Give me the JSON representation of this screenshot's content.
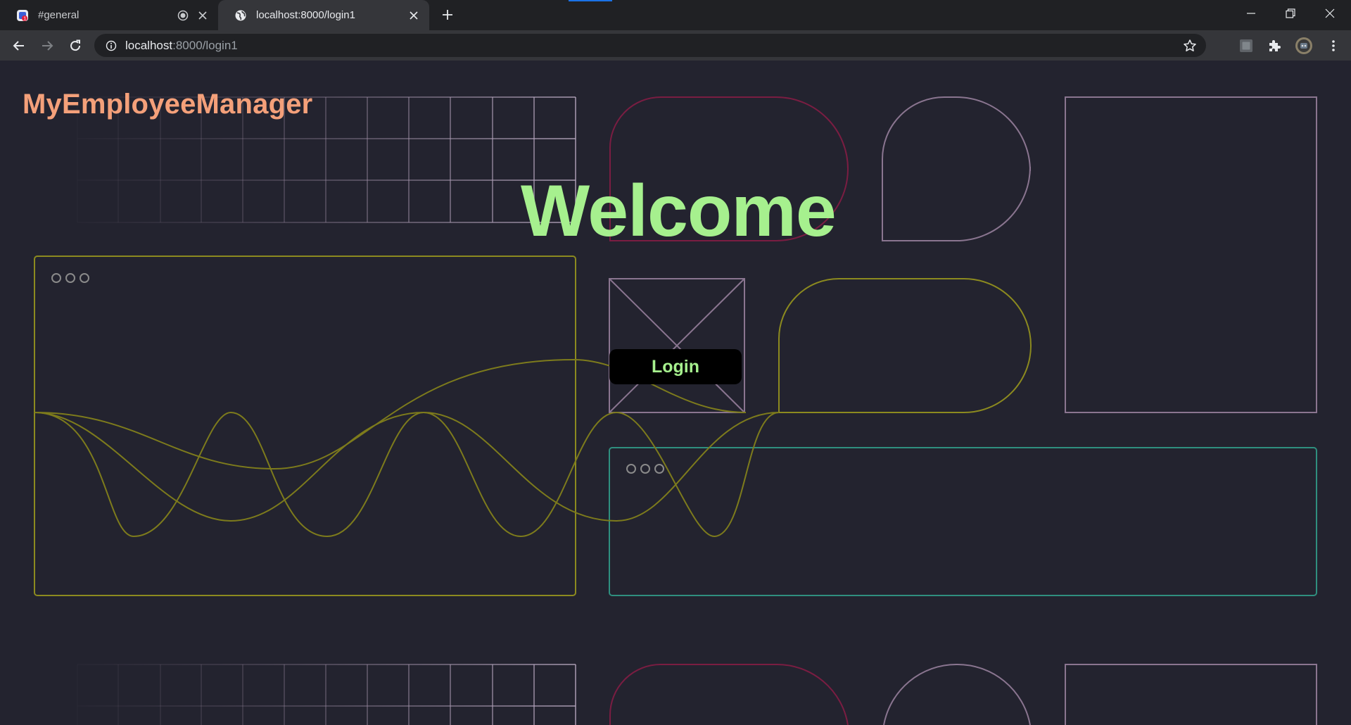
{
  "browser": {
    "tabs": [
      {
        "title": "#general",
        "active": false
      },
      {
        "title": "localhost:8000/login1",
        "active": true
      }
    ],
    "url_host": "localhost",
    "url_path": ":8000/login1"
  },
  "page": {
    "brand": "MyEmployeeManager",
    "heading": "Welcome",
    "login_label": "Login"
  },
  "colors": {
    "brand": "#f4a07a",
    "heading": "#a6f08e",
    "background": "#23232f",
    "accent_olive": "#8c8a1f",
    "accent_teal": "#2f8f7f",
    "accent_crimson": "#8a1f45",
    "accent_mauve": "#8a7590"
  },
  "icons": [
    "slack-favicon",
    "recording-icon",
    "close-icon",
    "globe-icon",
    "new-tab-icon",
    "minimize-icon",
    "restore-icon",
    "window-close-icon",
    "back-icon",
    "forward-icon",
    "reload-icon",
    "info-icon",
    "bookmark-star-icon",
    "extension-box-icon",
    "puzzle-icon",
    "profile-avatar",
    "more-menu-icon"
  ]
}
